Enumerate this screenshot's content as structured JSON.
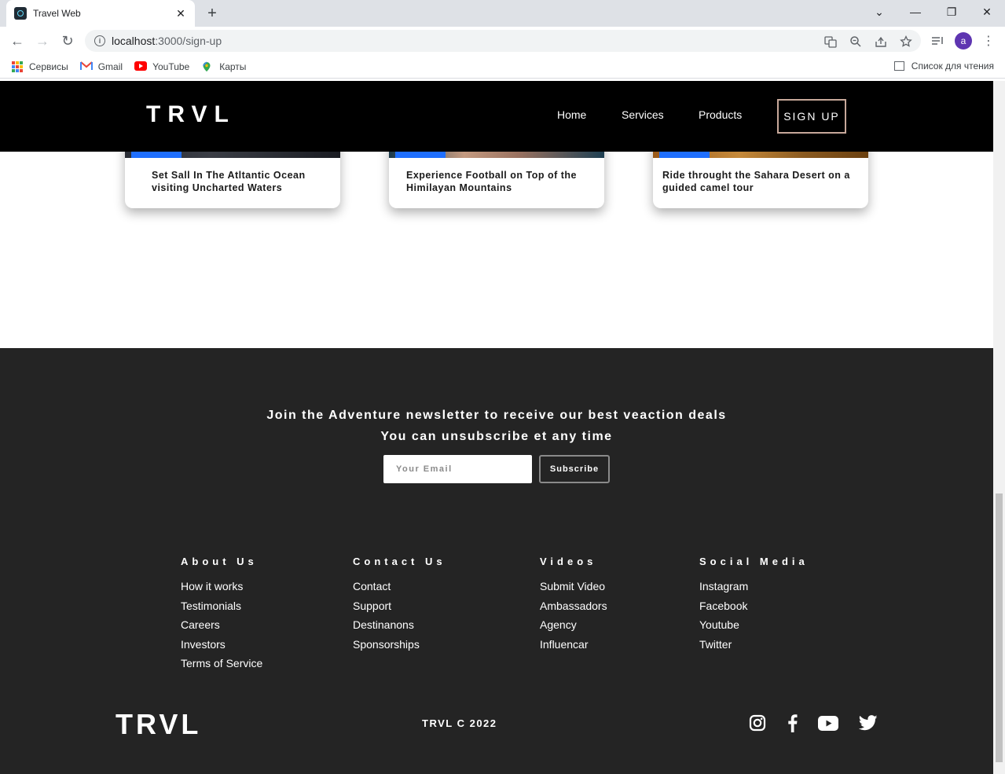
{
  "browser": {
    "tab_title": "Travel Web",
    "url_host": "localhost",
    "url_path": ":3000/sign-up",
    "avatar_letter": "a",
    "bookmarks": [
      "Сервисы",
      "Gmail",
      "YouTube",
      "Карты"
    ],
    "reading_list": "Список для чтения"
  },
  "nav": {
    "logo": "TRVL",
    "links": [
      "Home",
      "Services",
      "Products"
    ],
    "signup": "SIGN UP"
  },
  "cards": [
    {
      "title": "Set Sall In The Atltantic Ocean visiting Uncharted Waters"
    },
    {
      "title": "Experience Football on Top of the Himilayan Mountains"
    },
    {
      "title": "Ride throught the Sahara Desert on a guided camel tour"
    }
  ],
  "newsletter": {
    "heading": "Join the Adventure newsletter to receive our best veaction deals",
    "subheading": "You can unsubscribe et any time",
    "email_placeholder": "Your Email",
    "subscribe": "Subscribe"
  },
  "footer": {
    "columns": [
      {
        "title": "About Us",
        "links": [
          "How it works",
          "Testimonials",
          "Careers",
          "Investors",
          "Terms of Service"
        ]
      },
      {
        "title": "Contact Us",
        "links": [
          "Contact",
          "Support",
          "Destinanons",
          "Sponsorships"
        ]
      },
      {
        "title": "Videos",
        "links": [
          "Submit Video",
          "Ambassadors",
          "Agency",
          "Influencar"
        ]
      },
      {
        "title": "Social Media",
        "links": [
          "Instagram",
          "Facebook",
          "Youtube",
          "Twitter"
        ]
      }
    ],
    "logo": "TRVL",
    "copyright": "TRVL C 2022",
    "social_icons": [
      "instagram-icon",
      "facebook-icon",
      "youtube-icon",
      "twitter-icon"
    ]
  },
  "colors": {
    "nav_bg": "#000000",
    "footer_bg": "#242424",
    "card_tag": "#1f6fff",
    "signup_border": "#c7a89a"
  }
}
